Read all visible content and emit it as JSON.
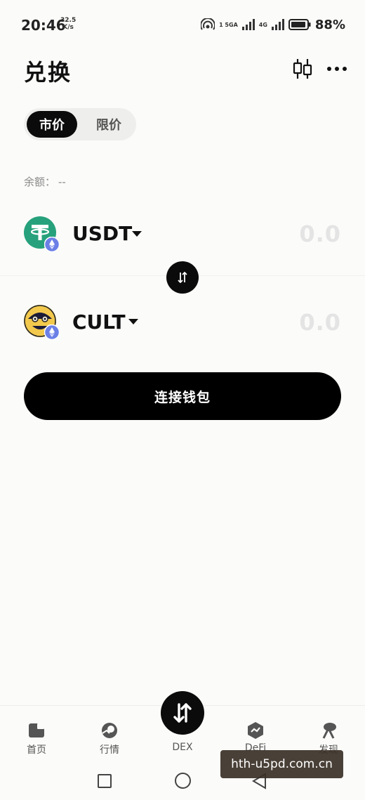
{
  "status_bar": {
    "time": "20:46",
    "net_speed_value": "32.5",
    "net_speed_unit": "K/s",
    "sim1_tag": "1 5GA",
    "sim2_tag": "4G",
    "battery": "88%"
  },
  "header": {
    "title": "兑换"
  },
  "order_type": {
    "active": "市价",
    "inactive": "限价"
  },
  "balance": {
    "label": "余额：",
    "value": "--"
  },
  "from_token": {
    "symbol": "USDT",
    "amount": "0.0",
    "icon": "tether-icon",
    "color": "#26a17b"
  },
  "to_token": {
    "symbol": "CULT",
    "amount": "0.0",
    "icon": "cult-icon"
  },
  "connect": {
    "label": "连接钱包"
  },
  "bottom_nav": {
    "items": [
      {
        "label": "首页",
        "icon": "home-icon"
      },
      {
        "label": "行情",
        "icon": "market-icon"
      },
      {
        "label": "DEX",
        "icon": "swap-icon"
      },
      {
        "label": "DeFi",
        "icon": "defi-icon"
      },
      {
        "label": "发现",
        "icon": "discover-icon"
      }
    ]
  },
  "watermark": {
    "text": "hth-u5pd.com.cn"
  }
}
